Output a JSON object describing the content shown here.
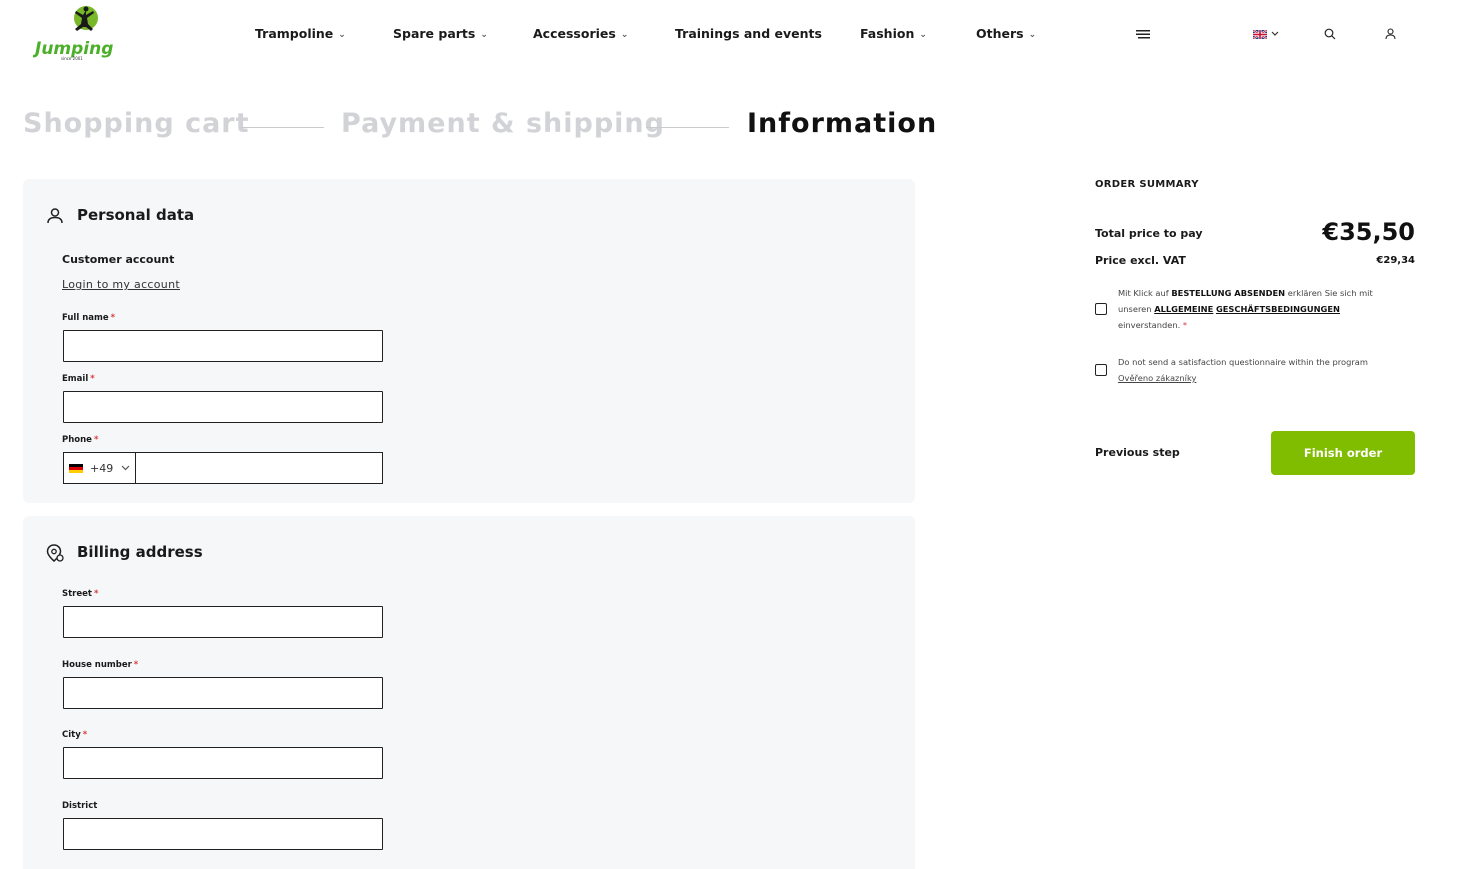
{
  "brand": {
    "logo_text": "Jumping",
    "logo_tagline": "since 2001",
    "accent": "#80bc00"
  },
  "nav": {
    "items": [
      {
        "label": "Trampoline",
        "has_dropdown": true
      },
      {
        "label": "Spare parts",
        "has_dropdown": true
      },
      {
        "label": "Accessories",
        "has_dropdown": true
      },
      {
        "label": "Trainings and events",
        "has_dropdown": false
      },
      {
        "label": "Fashion",
        "has_dropdown": true
      },
      {
        "label": "Others",
        "has_dropdown": true
      }
    ],
    "icons": [
      "menu-icon",
      "uk-flag-icon",
      "search-icon",
      "user-icon"
    ]
  },
  "steps": [
    {
      "label": "Shopping cart",
      "state": "done"
    },
    {
      "label": "Payment & shipping",
      "state": "done"
    },
    {
      "label": "Information",
      "state": "active"
    }
  ],
  "personal": {
    "title": "Personal data",
    "customer_account": "Customer account",
    "login_link": "Login to my account",
    "full_name_label": "Full name",
    "email_label": "Email",
    "phone_label": "Phone",
    "phone_prefix": "+49",
    "required_mark": "*"
  },
  "billing": {
    "title": "Billing address",
    "street_label": "Street",
    "house_number_label": "House number",
    "city_label": "City",
    "district_label": "District"
  },
  "summary": {
    "title": "ORDER SUMMARY",
    "total_label": "Total price to pay",
    "total_value": "€35,50",
    "excl_label": "Price excl. VAT",
    "excl_value": "€29,34",
    "terms_pre": "Mit Klick auf",
    "terms_bold1": "BESTELLUNG ABSENDEN",
    "terms_mid": "erklären Sie sich mit unseren",
    "terms_link1": "ALLGEMEINE",
    "terms_link2": "GESCHÄFTSBEDINGUNGEN",
    "terms_post": "einverstanden.",
    "questionnaire_text": "Do not send a satisfaction questionnaire within the program",
    "questionnaire_link": "Ověřeno zákazníky",
    "previous_step": "Previous step",
    "finish_order": "Finish order"
  }
}
